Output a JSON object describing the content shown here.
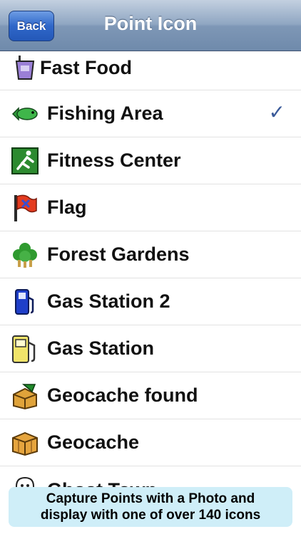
{
  "navbar": {
    "title": "Point Icon",
    "back_label": "Back"
  },
  "list": {
    "items": [
      {
        "label": "Fast Food",
        "icon": "fast-food-cup-icon",
        "selected": false
      },
      {
        "label": "Fishing Area",
        "icon": "fish-icon",
        "selected": true
      },
      {
        "label": "Fitness Center",
        "icon": "fitness-icon",
        "selected": false
      },
      {
        "label": "Flag",
        "icon": "flag-icon",
        "selected": false
      },
      {
        "label": "Forest Gardens",
        "icon": "tree-icon",
        "selected": false
      },
      {
        "label": "Gas Station 2",
        "icon": "fuel-icon",
        "selected": false
      },
      {
        "label": "Gas Station",
        "icon": "gas-pump-icon",
        "selected": false
      },
      {
        "label": "Geocache found",
        "icon": "geocache-open-icon",
        "selected": false
      },
      {
        "label": "Geocache",
        "icon": "geocache-box-icon",
        "selected": false
      },
      {
        "label": "Ghost Town",
        "icon": "ghost-icon",
        "selected": false
      }
    ],
    "checkmark": "✓"
  },
  "caption": {
    "line1": "Capture Points with a Photo and",
    "line2": "display with one of over 140 icons"
  },
  "colors": {
    "navbar": "#7e97b6",
    "back_button": "#2f67c9",
    "checkmark": "#3a5a99",
    "caption_bg": "#cfeef8"
  }
}
